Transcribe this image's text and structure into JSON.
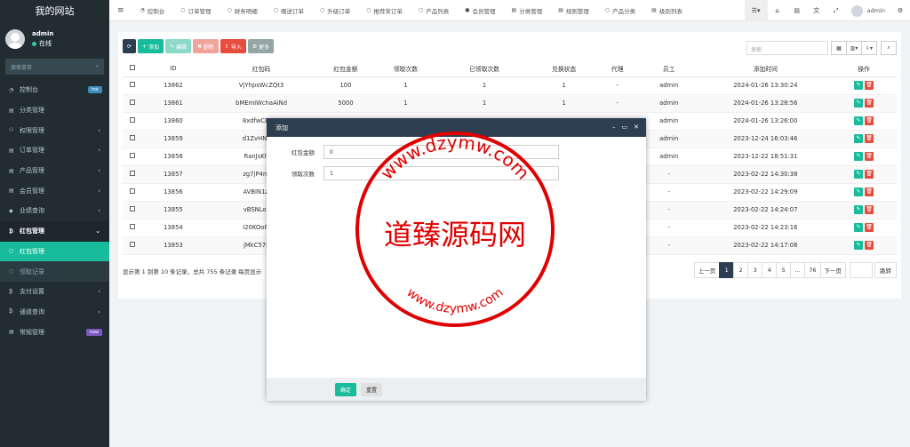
{
  "app": {
    "title": "我的网站"
  },
  "user": {
    "name": "admin",
    "status": "在线"
  },
  "sidebar": {
    "search_placeholder": "搜索菜单",
    "items": [
      {
        "label": "控制台",
        "icon": "dashboard-icon",
        "badge": "hot",
        "badge_color": "#3c8dbc"
      },
      {
        "label": "分类管理",
        "icon": "list-icon"
      },
      {
        "label": "权限管理",
        "icon": "group-icon",
        "arrow": "‹"
      },
      {
        "label": "订单管理",
        "icon": "list-icon",
        "arrow": "‹"
      },
      {
        "label": "产品管理",
        "icon": "list-icon",
        "arrow": "‹"
      },
      {
        "label": "会员管理",
        "icon": "list-icon",
        "arrow": "‹"
      },
      {
        "label": "业绩查询",
        "icon": "chart-icon",
        "arrow": "‹"
      },
      {
        "label": "红包管理",
        "icon": "bitcoin-icon",
        "arrow": "⌄"
      },
      {
        "label": "红包管理",
        "icon": "circle-icon",
        "sub": true,
        "active": true
      },
      {
        "label": "领取记录",
        "icon": "circle-icon",
        "sub": true
      },
      {
        "label": "支付设置",
        "icon": "bitcoin-icon",
        "arrow": "‹"
      },
      {
        "label": "通道查询",
        "icon": "bitcoin-icon",
        "arrow": "‹"
      },
      {
        "label": "常规管理",
        "icon": "list-icon",
        "badge": "new",
        "badge_color": "#7e57c2"
      }
    ]
  },
  "topbar": {
    "tabs": [
      {
        "label": "控制台",
        "icon": "dashboard-icon"
      },
      {
        "label": "订单管理",
        "icon": "circle-icon"
      },
      {
        "label": "财务明细",
        "icon": "circle-icon"
      },
      {
        "label": "赠送订单",
        "icon": "circle-icon"
      },
      {
        "label": "升级订单",
        "icon": "circle-icon"
      },
      {
        "label": "推荐奖订单",
        "icon": "circle-icon"
      },
      {
        "label": "产品列表",
        "icon": "circle-icon"
      },
      {
        "label": "会员管理",
        "icon": "user-icon"
      },
      {
        "label": "分类管理",
        "icon": "list-icon"
      },
      {
        "label": "规则管理",
        "icon": "list-icon"
      },
      {
        "label": "产品分类",
        "icon": "circle-icon"
      },
      {
        "label": "级别列表",
        "icon": "list-icon"
      }
    ],
    "admin_label": "admin"
  },
  "toolbar": {
    "add": "添加",
    "edit": "编辑",
    "delete": "删除",
    "import": "导入",
    "more": "更多",
    "search_placeholder": "搜索"
  },
  "table": {
    "headers": [
      "ID",
      "红包码",
      "红包金额",
      "领取次数",
      "已领取次数",
      "兑换状态",
      "代理",
      "员工",
      "添加时间",
      "操作"
    ],
    "rows": [
      {
        "id": "13862",
        "code": "VjYhpsWcZQt3",
        "amount": "100",
        "times": "1",
        "received": "1",
        "status": "1",
        "agent": "-",
        "staff": "admin",
        "time": "2024-01-26 13:30:24"
      },
      {
        "id": "13861",
        "code": "bMEmIWchaAiNd",
        "amount": "5000",
        "times": "1",
        "received": "1",
        "status": "1",
        "agent": "-",
        "staff": "admin",
        "time": "2024-01-26 13:28:56"
      },
      {
        "id": "13860",
        "code": "8xdfwCB6YF",
        "amount": "",
        "times": "",
        "received": "",
        "status": "",
        "agent": "-",
        "staff": "admin",
        "time": "2024-01-26 13:26:00"
      },
      {
        "id": "13859",
        "code": "d1ZvHNMUe",
        "amount": "",
        "times": "",
        "received": "",
        "status": "",
        "agent": "-",
        "staff": "admin",
        "time": "2023-12-24 16:03:46"
      },
      {
        "id": "13858",
        "code": "RanJsKhNrz",
        "amount": "",
        "times": "",
        "received": "",
        "status": "",
        "agent": "-",
        "staff": "admin",
        "time": "2023-12-22 18:51:31"
      },
      {
        "id": "13857",
        "code": "zg7jP4mlv5I",
        "amount": "",
        "times": "",
        "received": "",
        "status": "",
        "agent": "",
        "staff": "-",
        "time": "2023-02-22 14:30:38"
      },
      {
        "id": "13856",
        "code": "AVBIN1zx39",
        "amount": "",
        "times": "",
        "received": "",
        "status": "",
        "agent": "",
        "staff": "-",
        "time": "2023-02-22 14:29:09"
      },
      {
        "id": "13855",
        "code": "vBSNLob3IY",
        "amount": "",
        "times": "",
        "received": "",
        "status": "",
        "agent": "",
        "staff": "-",
        "time": "2023-02-22 14:24:07"
      },
      {
        "id": "13854",
        "code": "I20KOoP35A",
        "amount": "",
        "times": "",
        "received": "",
        "status": "",
        "agent": "",
        "staff": "-",
        "time": "2023-02-22 14:23:16"
      },
      {
        "id": "13853",
        "code": "jMkC57r4Lo",
        "amount": "",
        "times": "",
        "received": "",
        "status": "",
        "agent": "",
        "staff": "-",
        "time": "2023-02-22 14:17:08"
      }
    ]
  },
  "pagination": {
    "info": "显示第 1 到第 10 条记录，总共 755 条记录 每页显示",
    "prev": "上一页",
    "next": "下一页",
    "pages": [
      "1",
      "2",
      "3",
      "4",
      "5",
      "...",
      "76"
    ],
    "jump": "跳转"
  },
  "modal": {
    "title": "添加",
    "fields": [
      {
        "label": "红包金额",
        "value": "0"
      },
      {
        "label": "领取次数",
        "value": "1"
      }
    ],
    "ok": "确定",
    "reset": "重置"
  },
  "watermark": {
    "center_text": "道臻源码网",
    "url_top": "www.dzymw.com",
    "url_bottom": "www.dzymw.com"
  },
  "colors": {
    "primary": "#18bc9c",
    "danger": "#e74c3c",
    "dark": "#2c3e50",
    "sidebar": "#222d32",
    "stamp": "#e00000"
  }
}
